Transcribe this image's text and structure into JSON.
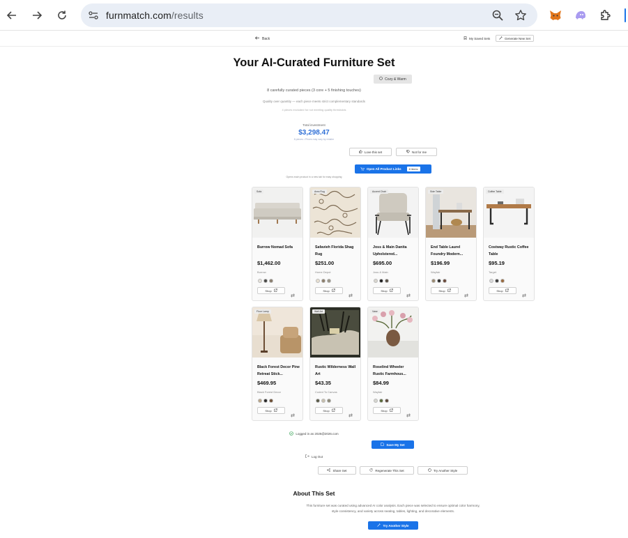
{
  "browser": {
    "url_domain": "furnmatch.com",
    "url_path": "/results"
  },
  "header": {
    "back_label": "Back",
    "saved_label": "My Saved Sets",
    "generate_label": "Generate New Set"
  },
  "hero": {
    "title": "Your AI-Curated Furniture Set",
    "style_badge": "Cozy & Warm",
    "subtitle": "8 carefully curated pieces (3 core + 5 finishing touches)",
    "quality_note": "Quality over quantity — each piece meets strict complementary standards",
    "excluded_note": "4 pieces excluded for not meeting quality thresholds",
    "investment_label": "Total investment",
    "investment_value": "$3,298.47",
    "investment_note": "8 pieces • Prices may vary by retailer"
  },
  "feedback": {
    "love_label": "Love this set",
    "not_label": "Not for me"
  },
  "open_all": {
    "label": "Open All Product Links",
    "count": "8 items",
    "note": "Opens each product in a new tab for easy shopping"
  },
  "products": [
    {
      "tag": "Sofa",
      "name": "Burrow Nomad Sofa",
      "price": "$1,462.00",
      "store": "Burrow",
      "swatches": [
        "#e6e2da",
        "#4a4a48",
        "#8a7e6e"
      ]
    },
    {
      "tag": "Area Rug",
      "name": "Safavieh Florida Shag Rug",
      "price": "$251.00",
      "store": "Home Depot",
      "swatches": [
        "#e8e0d2",
        "#8c7e6a",
        "#9a9486"
      ]
    },
    {
      "tag": "Accent Chair",
      "name": "Joss & Main Danita Upholstered...",
      "price": "$695.00",
      "store": "Joss & Main",
      "swatches": [
        "#d9d6cf",
        "#1f1f1f",
        "#5a5248"
      ]
    },
    {
      "tag": "Side Table",
      "name": "End Table Laurel Foundry Modern...",
      "price": "$196.99",
      "store": "Wayfair",
      "swatches": [
        "#9c8b72",
        "#2b2b2b",
        "#6b4a3a"
      ]
    },
    {
      "tag": "Coffee Table",
      "name": "Costway Rustic Coffee Table",
      "price": "$95.19",
      "store": "Target",
      "swatches": [
        "#d8d8d8",
        "#3a3a3a",
        "#9a6a3e"
      ]
    },
    {
      "tag": "Floor Lamp",
      "name": "Black Forest Decor Pine Retreat Stick...",
      "price": "$469.95",
      "store": "Black Forest Decor",
      "swatches": [
        "#b9a486",
        "#2a2a2a",
        "#6d4e34"
      ]
    },
    {
      "tag": "Wall Art",
      "name": "Rustic Wilderness Wall Art",
      "price": "$43.35",
      "store": "Coded To Canvas",
      "swatches": [
        "#5a5a48",
        "#c8c0ae",
        "#8e8a78"
      ]
    },
    {
      "tag": "Vase",
      "name": "Roselind Wheeler Rustic Farmhous...",
      "price": "$84.99",
      "store": "Wayfair",
      "swatches": [
        "#d6d6d0",
        "#5a6a3a",
        "#5e4a3a"
      ]
    }
  ],
  "card_shop_label": "Shop",
  "account": {
    "logged_in": "Logged in as 2026@2026.com",
    "save_label": "Save My Set",
    "logout_label": "Log Out"
  },
  "actions": {
    "share_label": "Share Set",
    "regen_label": "Regenerate This Set",
    "another_label": "Try Another Style"
  },
  "about": {
    "title": "About This Set",
    "text": "This furniture set was curated using advanced AI color analysis. Each piece was selected to ensure optimal color harmony, style consistency, and variety across seating, tables, lighting, and decorative elements.",
    "cta": "Try Another Style"
  },
  "colors": {
    "accent": "#1a73e8",
    "price_accent": "#2f6fd6"
  }
}
